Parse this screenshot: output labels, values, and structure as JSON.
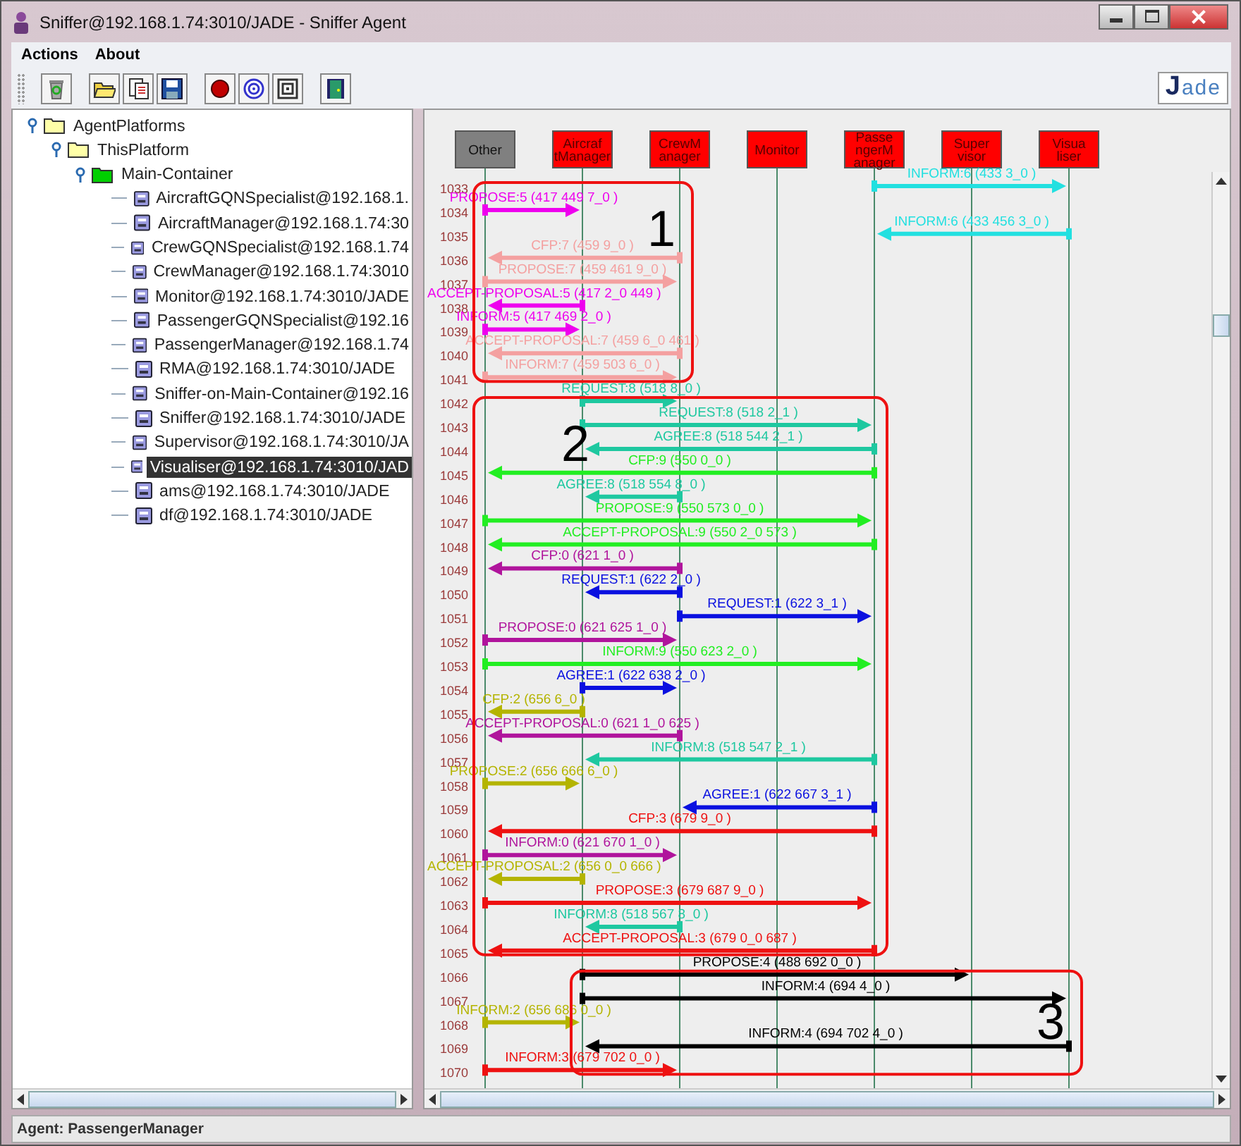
{
  "window": {
    "title": "Sniffer@192.168.1.74:3010/JADE - Sniffer Agent"
  },
  "menu": [
    "Actions",
    "About"
  ],
  "logo": "Jade",
  "tree": {
    "label": "AgentPlatforms",
    "kind": "folder",
    "expanded": true,
    "selected": false,
    "children": [
      {
        "label": "ThisPlatform",
        "kind": "folder",
        "expanded": true,
        "selected": false,
        "children": [
          {
            "label": "Main-Container",
            "kind": "container",
            "expanded": true,
            "selected": false,
            "children": [
              {
                "label": "AircraftGQNSpecialist@192.168.1.",
                "kind": "agent",
                "selected": false
              },
              {
                "label": "AircraftManager@192.168.1.74:30",
                "kind": "agent",
                "selected": false
              },
              {
                "label": "CrewGQNSpecialist@192.168.1.74",
                "kind": "agent",
                "selected": false
              },
              {
                "label": "CrewManager@192.168.1.74:3010",
                "kind": "agent",
                "selected": false
              },
              {
                "label": "Monitor@192.168.1.74:3010/JADE",
                "kind": "agent",
                "selected": false
              },
              {
                "label": "PassengerGQNSpecialist@192.16",
                "kind": "agent",
                "selected": false
              },
              {
                "label": "PassengerManager@192.168.1.74",
                "kind": "agent",
                "selected": false
              },
              {
                "label": "RMA@192.168.1.74:3010/JADE",
                "kind": "agent",
                "selected": false
              },
              {
                "label": "Sniffer-on-Main-Container@192.16",
                "kind": "agent",
                "selected": false
              },
              {
                "label": "Sniffer@192.168.1.74:3010/JADE",
                "kind": "agent",
                "selected": false
              },
              {
                "label": "Supervisor@192.168.1.74:3010/JA",
                "kind": "agent",
                "selected": false
              },
              {
                "label": "Visualiser@192.168.1.74:3010/JAD",
                "kind": "agent",
                "selected": true
              },
              {
                "label": "ams@192.168.1.74:3010/JADE",
                "kind": "agent",
                "selected": false
              },
              {
                "label": "df@192.168.1.74:3010/JADE",
                "kind": "agent",
                "selected": false
              }
            ]
          }
        ]
      }
    ]
  },
  "sniffer": {
    "agents": [
      {
        "lines": [
          "Other"
        ],
        "color": "#808080"
      },
      {
        "lines": [
          "Aircraf",
          "tManager"
        ],
        "color": "#ff0000"
      },
      {
        "lines": [
          "CrewM",
          "anager"
        ],
        "color": "#ff0000"
      },
      {
        "lines": [
          "Monitor"
        ],
        "color": "#ff0000"
      },
      {
        "lines": [
          "Passe",
          "ngerM",
          "anager"
        ],
        "color": "#ff0000"
      },
      {
        "lines": [
          "Super",
          "visor"
        ],
        "color": "#ff0000"
      },
      {
        "lines": [
          "Visua",
          "liser"
        ],
        "color": "#ff0000"
      }
    ],
    "groups": [
      {
        "label": "1",
        "messages": [
          {
            "number": "1033",
            "label": "INFORM:6 (433 3_0 )",
            "color": "#22e0e0"
          },
          {
            "number": "1034",
            "label": "PROPOSE:5 (417 449 7_0 )",
            "color": "#ee00ee"
          },
          {
            "number": "1035",
            "label": "INFORM:6 (433 456 3_0 )",
            "color": "#22e0e0"
          },
          {
            "number": "1036",
            "label": "CFP:7 (459 9_0 )",
            "color": "#f4a0a0"
          },
          {
            "number": "1037",
            "label": "PROPOSE:7 (459 461 9_0 )",
            "color": "#f4a0a0"
          },
          {
            "number": "1038",
            "label": "ACCEPT-PROPOSAL:5 (417 2_0 449 )",
            "color": "#ee00ee"
          },
          {
            "number": "1039",
            "label": "INFORM:5 (417 469 2_0 )",
            "color": "#ee00ee"
          },
          {
            "number": "1040",
            "label": "ACCEPT-PROPOSAL:7 (459 6_0 461 )",
            "color": "#f4a0a0"
          },
          {
            "number": "1041",
            "label": "INFORM:7 (459 503 6_0 )",
            "color": "#f4a0a0"
          }
        ]
      },
      {
        "label": "2",
        "messages": [
          {
            "number": "1042",
            "label": "REQUEST:8 (518 8_0 )",
            "color": "#1ec8a0"
          },
          {
            "number": "1043",
            "label": "REQUEST:8 (518 2_1 )",
            "color": "#1ec8a0"
          },
          {
            "number": "1044",
            "label": "AGREE:8 (518 544 2_1 )",
            "color": "#1ec8a0"
          },
          {
            "number": "1045",
            "label": "CFP:9 (550 0_0 )",
            "color": "#22ee22"
          },
          {
            "number": "1046",
            "label": "AGREE:8 (518 554 8_0 )",
            "color": "#1ec8a0"
          },
          {
            "number": "1047",
            "label": "PROPOSE:9 (550 573 0_0 )",
            "color": "#22ee22"
          },
          {
            "number": "1048",
            "label": "ACCEPT-PROPOSAL:9 (550 2_0 573 )",
            "color": "#22ee22"
          },
          {
            "number": "1049",
            "label": "CFP:0 (621 1_0 )",
            "color": "#b0149c"
          },
          {
            "number": "1050",
            "label": "REQUEST:1 (622 2_0 )",
            "color": "#0a10e0"
          },
          {
            "number": "1051",
            "label": "REQUEST:1 (622 3_1 )",
            "color": "#0a10e0"
          },
          {
            "number": "1052",
            "label": "PROPOSE:0 (621 625 1_0 )",
            "color": "#b0149c"
          },
          {
            "number": "1053",
            "label": "INFORM:9 (550 623 2_0 )",
            "color": "#22ee22"
          },
          {
            "number": "1054",
            "label": "AGREE:1 (622 638 2_0 )",
            "color": "#0a10e0"
          },
          {
            "number": "1055",
            "label": "CFP:2 (656 6_0 )",
            "color": "#b4b400"
          },
          {
            "number": "1056",
            "label": "ACCEPT-PROPOSAL:0 (621 1_0 625 )",
            "color": "#b0149c"
          },
          {
            "number": "1057",
            "label": "INFORM:8 (518 547 2_1 )",
            "color": "#1ec8a0"
          },
          {
            "number": "1058",
            "label": "PROPOSE:2 (656 666 6_0 )",
            "color": "#b4b400"
          },
          {
            "number": "1059",
            "label": "AGREE:1 (622 667 3_1 )",
            "color": "#0a10e0"
          },
          {
            "number": "1060",
            "label": "CFP:3 (679 9_0 )",
            "color": "#ee1111"
          },
          {
            "number": "1061",
            "label": "INFORM:0 (621 670 1_0 )",
            "color": "#b0149c"
          },
          {
            "number": "1062",
            "label": "ACCEPT-PROPOSAL:2 (656 0_0 666 )",
            "color": "#b4b400"
          },
          {
            "number": "1063",
            "label": "PROPOSE:3 (679 687 9_0 )",
            "color": "#ee1111"
          },
          {
            "number": "1064",
            "label": "INFORM:8 (518 567 8_0 )",
            "color": "#1ec8a0"
          },
          {
            "number": "1065",
            "label": "ACCEPT-PROPOSAL:3 (679 0_0 687 )",
            "color": "#ee1111"
          }
        ]
      },
      {
        "label": "3",
        "messages": [
          {
            "number": "1066",
            "label": "PROPOSE:4 (488 692 0_0 )",
            "color": "#000000"
          },
          {
            "number": "1067",
            "label": "INFORM:4 (694 4_0 )",
            "color": "#000000"
          },
          {
            "number": "1068",
            "label": "INFORM:2 (656 686 0_0 )",
            "color": "#b4b400"
          },
          {
            "number": "1069",
            "label": "INFORM:4 (694 702 4_0 )",
            "color": "#000000"
          },
          {
            "number": "1070",
            "label": "INFORM:3 (679 702 0_0 )",
            "color": "#ee1111"
          }
        ]
      }
    ]
  },
  "status_bar": "Agent: PassengerManager"
}
